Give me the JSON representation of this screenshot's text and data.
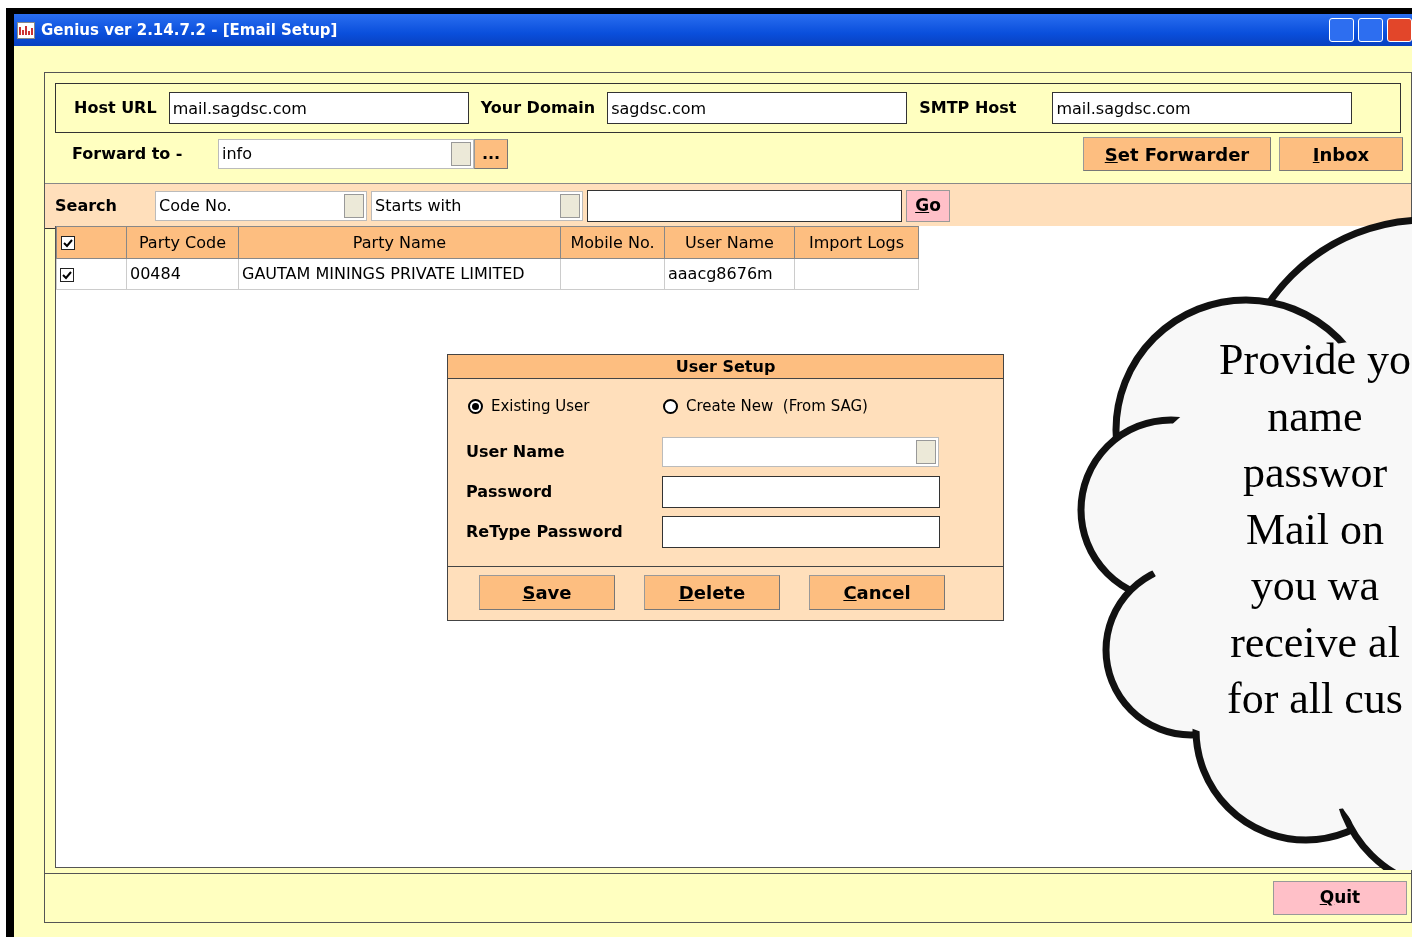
{
  "window": {
    "title": "Genius ver 2.14.7.2 - [Email Setup]"
  },
  "host_fields": [
    {
      "label": "Host URL",
      "value": "mail.sagdsc.com"
    },
    {
      "label": "Your Domain",
      "value": "sagdsc.com"
    },
    {
      "label": "SMTP Host",
      "value": "mail.sagdsc.com"
    }
  ],
  "forward": {
    "label": "Forward to -",
    "value": "info",
    "browse": "..."
  },
  "top_buttons": [
    {
      "label": "Set Forwarder",
      "underline_first": true
    },
    {
      "label": "Inbox",
      "underline_first": true
    }
  ],
  "search": {
    "label": "Search",
    "field": "Code No.",
    "mode": "Starts with",
    "go": {
      "label": "Go",
      "underline_first": true
    }
  },
  "table": {
    "header_checked": true,
    "columns": [
      "Party Code",
      "Party Name",
      "Mobile No.",
      "User Name",
      "Import Logs"
    ],
    "rows": [
      {
        "checked": true,
        "cells": [
          "00484",
          "GAUTAM MININGS PRIVATE LIMITED",
          "",
          "aaacg8676m",
          ""
        ]
      }
    ]
  },
  "dialog": {
    "title": "User Setup",
    "options": [
      {
        "label": "Existing User",
        "selected": true
      },
      {
        "label": "Create New  (From SAG)",
        "selected": false
      }
    ],
    "fields": [
      {
        "label": "User Name",
        "kind": "dropdown"
      },
      {
        "label": "Password",
        "kind": "text"
      },
      {
        "label": "ReType Password",
        "kind": "text"
      }
    ],
    "buttons": [
      {
        "label": "Save",
        "underline_first": true
      },
      {
        "label": "Delete",
        "underline_first": true
      },
      {
        "label": "Cancel",
        "underline_first": true
      }
    ]
  },
  "quit": {
    "label": "Quit",
    "underline_first": true
  },
  "callout": {
    "lines": [
      "Provide yo",
      "name",
      "passwor",
      "Mail on",
      "you wa",
      "receive al",
      "for all cus"
    ]
  }
}
